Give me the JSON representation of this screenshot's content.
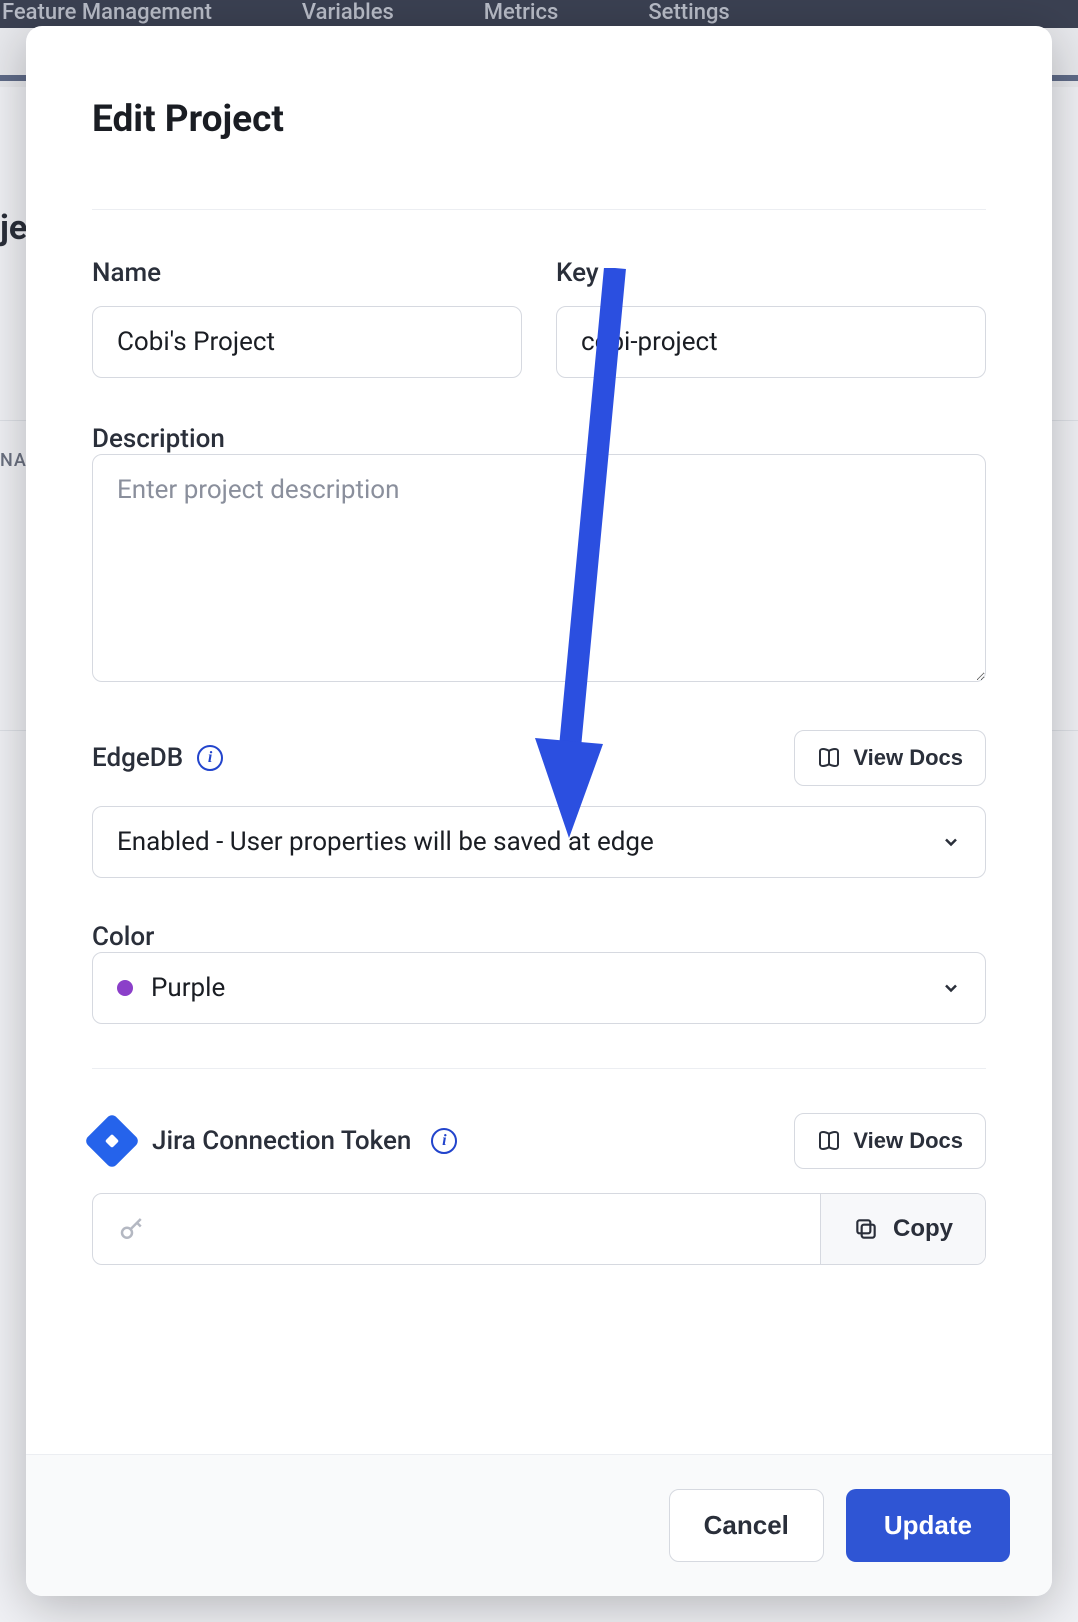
{
  "topnav": {
    "items": [
      "Feature Management",
      "Variables",
      "Metrics",
      "Settings"
    ]
  },
  "background": {
    "partial1": "je",
    "partial2": "NA"
  },
  "modal": {
    "title": "Edit Project",
    "name": {
      "label": "Name",
      "value": "Cobi's Project"
    },
    "key": {
      "label": "Key",
      "value": "cobi-project"
    },
    "description": {
      "label": "Description",
      "value": "",
      "placeholder": "Enter project description"
    },
    "edgedb": {
      "label": "EdgeDB",
      "docs_label": "View Docs",
      "selected": "Enabled - User properties will be saved at edge"
    },
    "color": {
      "label": "Color",
      "selected": "Purple",
      "swatch": "#8b3fc9"
    },
    "jira": {
      "label": "Jira Connection Token",
      "docs_label": "View Docs",
      "token": "",
      "copy_label": "Copy"
    },
    "footer": {
      "cancel": "Cancel",
      "update": "Update"
    }
  },
  "annotation": {
    "arrow_color": "#2b4fe0"
  }
}
